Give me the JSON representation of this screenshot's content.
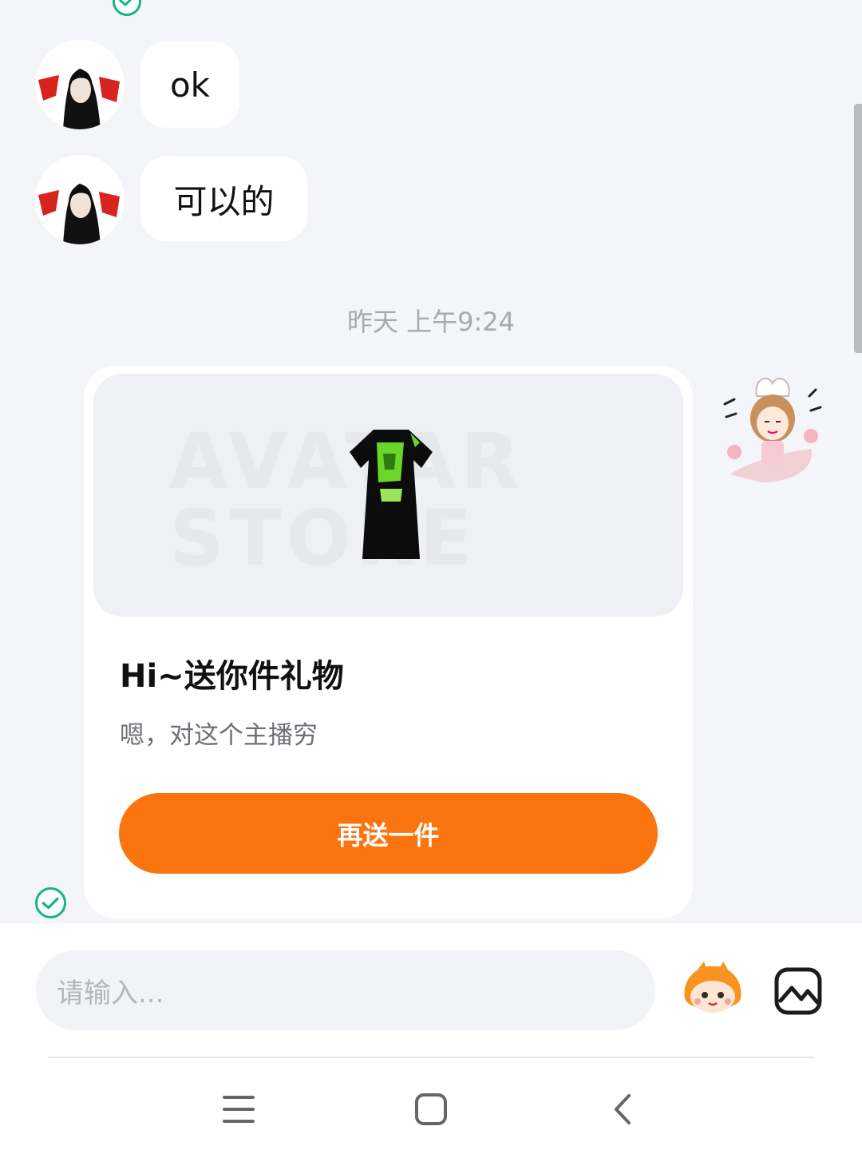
{
  "messages": [
    {
      "sender": "contact",
      "text": "ok"
    },
    {
      "sender": "contact",
      "text": "可以的"
    }
  ],
  "timestamp": "昨天 上午9:24",
  "gift_card": {
    "image_brand": "AVATAR STORE",
    "title": "Hi~送你件礼物",
    "subtitle": "嗯，对这个主播穷",
    "button_label": "再送一件"
  },
  "composer": {
    "placeholder": "请输入..."
  },
  "colors": {
    "accent": "#fa7510",
    "read_check": "#14b488",
    "background": "#f4f5f8"
  },
  "icons": {
    "emoji": "emoji-mascot-icon",
    "image": "image-picker-icon",
    "nav_menu": "menu-icon",
    "nav_home": "home-icon",
    "nav_back": "back-icon"
  }
}
